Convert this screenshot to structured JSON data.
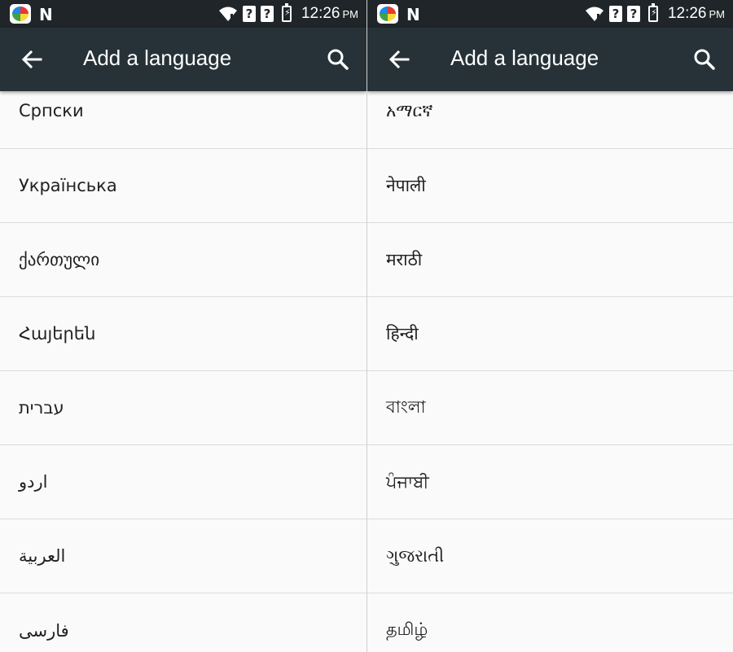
{
  "status": {
    "time": "12:26",
    "ampm": "PM",
    "unknown_icon": "?"
  },
  "appbar": {
    "title": "Add a language",
    "back_icon": "arrow-back-icon",
    "search_icon": "search-icon"
  },
  "left_list": [
    "Српски",
    "Українська",
    "ქართული",
    "Հայերեն",
    "עברית",
    "اردو",
    "العربية",
    "فارسی"
  ],
  "right_list": [
    "አማርኛ",
    "नेपाली",
    "मराठी",
    "हिन्दी",
    "বাংলা",
    "ਪੰਜਾਬੀ",
    "ગુજરાતી",
    "தமிழ்"
  ],
  "colors": {
    "statusbar": "#1f2528",
    "appbar": "#263238",
    "background": "#fafafa",
    "divider": "#dcdcdc"
  }
}
